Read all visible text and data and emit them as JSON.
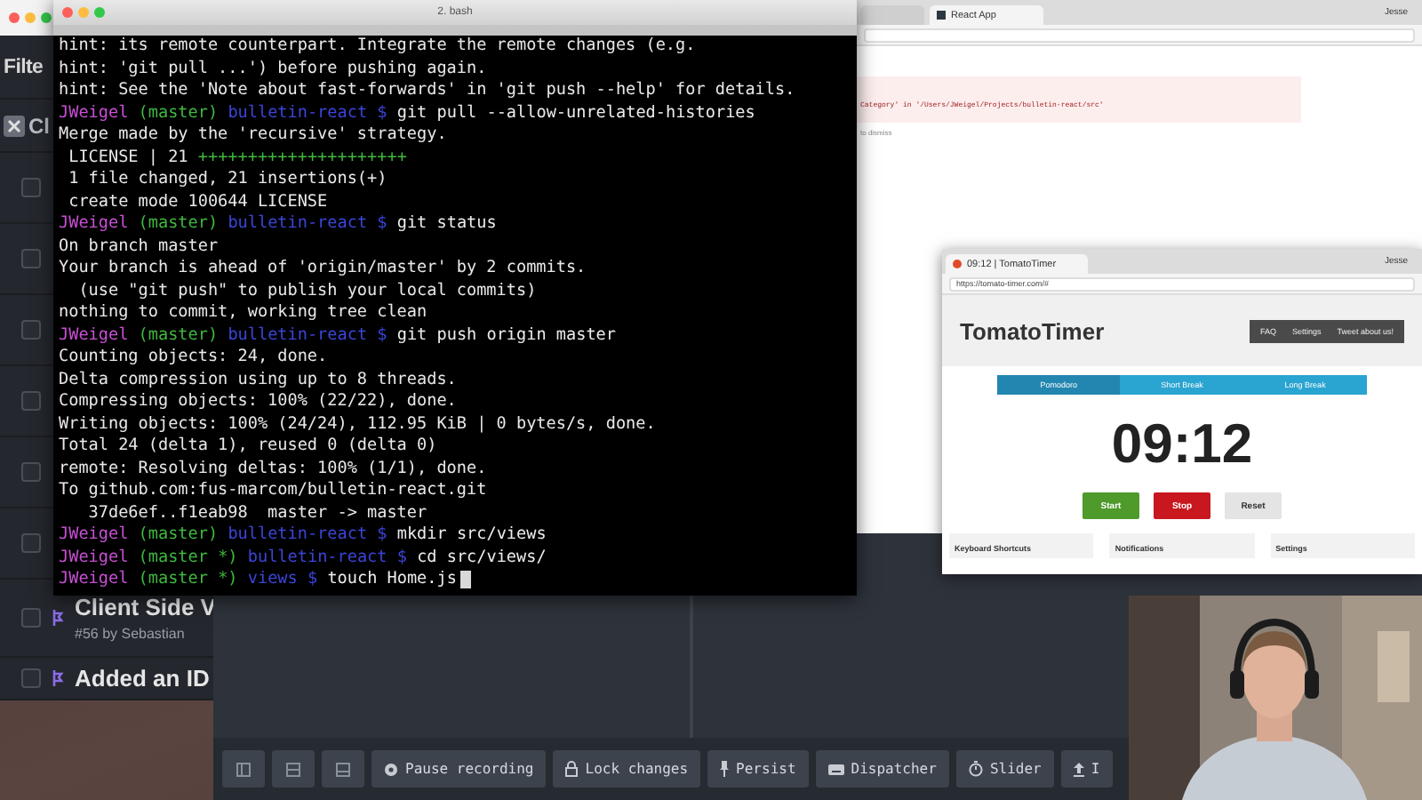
{
  "left_window": {
    "filter": "Filte",
    "clear_chip": "Cl",
    "rows": [
      {
        "checked": false
      },
      {
        "checked": false
      },
      {
        "checked": false
      },
      {
        "checked": false
      },
      {
        "checked": false
      },
      {
        "checked": false
      },
      {
        "checked": false,
        "title": "Client Side V",
        "subtitle": "#56 by Sebastian"
      },
      {
        "checked": false,
        "title": "Added an ID"
      }
    ]
  },
  "terminal": {
    "title": "2. bash",
    "cursor": true,
    "lines": [
      {
        "kind": "out",
        "text": "hint: its remote counterpart. Integrate the remote changes (e.g."
      },
      {
        "kind": "out",
        "text": "hint: 'git pull ...') before pushing again."
      },
      {
        "kind": "out",
        "text": "hint: See the 'Note about fast-forwards' in 'git push --help' for details."
      },
      {
        "kind": "prompt",
        "user": "JWeigel",
        "branch": "(master)",
        "dir": "bulletin-react $",
        "command": "git pull --allow-unrelated-histories"
      },
      {
        "kind": "out",
        "text": "Merge made by the 'recursive' strategy."
      },
      {
        "kind": "stat",
        "text": " LICENSE | 21",
        "plus": "+++++++++++++++++++++"
      },
      {
        "kind": "out",
        "text": " 1 file changed, 21 insertions(+)"
      },
      {
        "kind": "out",
        "text": " create mode 100644 LICENSE"
      },
      {
        "kind": "prompt",
        "user": "JWeigel",
        "branch": "(master)",
        "dir": "bulletin-react $",
        "command": "git status"
      },
      {
        "kind": "out",
        "text": "On branch master"
      },
      {
        "kind": "out",
        "text": "Your branch is ahead of 'origin/master' by 2 commits."
      },
      {
        "kind": "out",
        "text": "  (use \"git push\" to publish your local commits)"
      },
      {
        "kind": "out",
        "text": "nothing to commit, working tree clean"
      },
      {
        "kind": "prompt",
        "user": "JWeigel",
        "branch": "(master)",
        "dir": "bulletin-react $",
        "command": "git push origin master"
      },
      {
        "kind": "out",
        "text": "Counting objects: 24, done."
      },
      {
        "kind": "out",
        "text": "Delta compression using up to 8 threads."
      },
      {
        "kind": "out",
        "text": "Compressing objects: 100% (22/22), done."
      },
      {
        "kind": "out",
        "text": "Writing objects: 100% (24/24), 112.95 KiB | 0 bytes/s, done."
      },
      {
        "kind": "out",
        "text": "Total 24 (delta 1), reused 0 (delta 0)"
      },
      {
        "kind": "out",
        "text": "remote: Resolving deltas: 100% (1/1), done."
      },
      {
        "kind": "out",
        "text": "To github.com:fus-marcom/bulletin-react.git"
      },
      {
        "kind": "out",
        "text": "   37de6ef..f1eab98  master -> master"
      },
      {
        "kind": "prompt",
        "user": "JWeigel",
        "branch": "(master)",
        "dir": "bulletin-react $",
        "command": "mkdir src/views"
      },
      {
        "kind": "prompt",
        "user": "JWeigel",
        "branch": "(master *)",
        "dir": "bulletin-react $",
        "command": "cd src/views/"
      },
      {
        "kind": "prompt",
        "user": "JWeigel",
        "branch": "(master *)",
        "dir": "views $",
        "command": "touch Home.js"
      }
    ]
  },
  "browser": {
    "tabs": [
      {
        "label": "React App",
        "selected": true
      }
    ],
    "user": "Jesse",
    "error_lines": [
      "Category' in '/Users/JWeigel/Projects/bulletin-react/src'",
      "to dismiss"
    ]
  },
  "timer_window": {
    "tab": "09:12 | TomatoTimer",
    "user": "Jesse",
    "url": "https://tomato-timer.com/#",
    "brand": "TomatoTimer",
    "nav": [
      "FAQ",
      "Settings",
      "Tweet about us!"
    ],
    "modes": [
      {
        "label": "Pomodoro",
        "selected": true
      },
      {
        "label": "Short Break",
        "selected": false
      },
      {
        "label": "Long Break",
        "selected": false
      }
    ],
    "time": "09:12",
    "buttons": [
      {
        "label": "Start",
        "color": "#4e9a2a"
      },
      {
        "label": "Stop",
        "color": "#c8171e"
      },
      {
        "label": "Reset",
        "color": "#e4e4e4"
      }
    ],
    "cards": [
      "Keyboard Shortcuts",
      "Notifications",
      "Settings"
    ]
  },
  "devtools": {
    "toolbar": [
      {
        "kind": "icon"
      },
      {
        "kind": "icon"
      },
      {
        "kind": "icon"
      },
      {
        "kind": "text",
        "label": "Pause recording"
      },
      {
        "kind": "text",
        "label": "Lock changes"
      },
      {
        "kind": "text",
        "label": "Persist"
      },
      {
        "kind": "text",
        "label": "Dispatcher"
      },
      {
        "kind": "text",
        "label": "Slider"
      },
      {
        "kind": "text",
        "label": "I"
      }
    ]
  }
}
